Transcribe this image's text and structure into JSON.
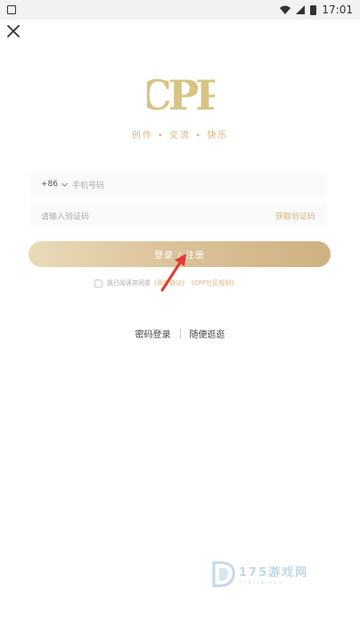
{
  "status_bar": {
    "time": "17:01"
  },
  "logo": {
    "text": "CPP",
    "tagline": "创作 • 交流 • 快乐"
  },
  "form": {
    "country_code": "+86",
    "phone_placeholder": "手机号码",
    "code_placeholder": "请输入验证码",
    "get_code_label": "获取验证码",
    "login_button_label": "登录 / 注册"
  },
  "agreement": {
    "prefix": "我已阅读并同意",
    "user_agreement": "《用户协议》",
    "community_rules": "《CPP社区规则》"
  },
  "alt_actions": {
    "password_login": "密码登录",
    "browse": "随便逛逛"
  },
  "watermark": {
    "title": "175游戏网",
    "subtitle": "175xzw.com"
  },
  "colors": {
    "accent": "#d4b47c",
    "button_start": "#e9dab8",
    "button_end": "#cfb181",
    "annotation_arrow": "#e53935"
  }
}
